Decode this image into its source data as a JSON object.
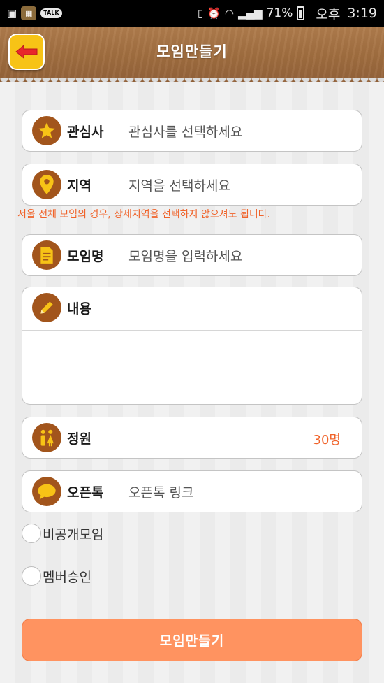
{
  "status_bar": {
    "talk_badge": "TALK",
    "battery_percent": "71%",
    "ampm": "오후",
    "time": "3:19"
  },
  "header": {
    "title": "모임만들기"
  },
  "form": {
    "interest": {
      "label": "관심사",
      "placeholder": "관심사를 선택하세요"
    },
    "region": {
      "label": "지역",
      "placeholder": "지역을 선택하세요"
    },
    "region_notice": "서울 전체 모임의 경우, 상세지역을 선택하지 않으셔도 됩니다.",
    "meeting_name": {
      "label": "모임명",
      "placeholder": "모임명을 입력하세요"
    },
    "content": {
      "label": "내용",
      "value": ""
    },
    "capacity": {
      "label": "정원",
      "value": "30명"
    },
    "open_talk": {
      "label": "오픈톡",
      "placeholder": "오픈톡 링크"
    },
    "private_option": {
      "label": "비공개모임",
      "checked": false
    },
    "member_approval": {
      "label": "멤버승인",
      "checked": false
    }
  },
  "submit_button": {
    "label": "모임만들기"
  },
  "colors": {
    "accent_orange": "#ff9360",
    "notice_text": "#f0632a",
    "icon_brown": "#a2551c",
    "header_wood": "#a06d3f",
    "back_button_yellow": "#f7c316",
    "back_arrow_red": "#e8262b"
  }
}
